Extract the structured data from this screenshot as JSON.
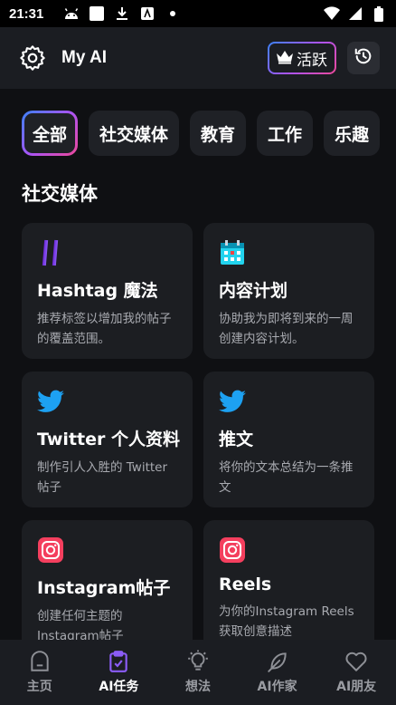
{
  "status_bar": {
    "time": "21:31"
  },
  "header": {
    "title": "My AI",
    "vip_label": "活跃"
  },
  "tabs": [
    {
      "label": "全部",
      "active": true
    },
    {
      "label": "社交媒体"
    },
    {
      "label": "教育"
    },
    {
      "label": "工作"
    },
    {
      "label": "乐趣"
    }
  ],
  "section": {
    "title": "社交媒体"
  },
  "cards": [
    {
      "icon": "hashtag-icon",
      "title": "Hashtag 魔法",
      "desc": "推荐标签以增加我的帖子的覆盖范围。"
    },
    {
      "icon": "calendar-icon",
      "title": "内容计划",
      "desc": "协助我为即将到来的一周创建内容计划。"
    },
    {
      "icon": "twitter-icon",
      "title": "Twitter 个人资料",
      "desc": "制作引人入胜的 Twitter 帖子"
    },
    {
      "icon": "twitter-icon",
      "title": "推文",
      "desc": "将你的文本总结为一条推文"
    },
    {
      "icon": "instagram-icon",
      "title": "Instagram帖子",
      "desc": "创建任何主题的Instagram帖子"
    },
    {
      "icon": "instagram-icon",
      "title": "Reels",
      "desc": "为你的Instagram Reels获取创意描述"
    }
  ],
  "bottom_nav": [
    {
      "label": "主页",
      "icon": "home-icon"
    },
    {
      "label": "AI任务",
      "icon": "clipboard-icon",
      "active": true
    },
    {
      "label": "想法",
      "icon": "lightbulb-icon"
    },
    {
      "label": "AI作家",
      "icon": "feather-icon"
    },
    {
      "label": "AI朋友",
      "icon": "heart-icon"
    }
  ],
  "colors": {
    "accent_blue": "#3b82f6",
    "accent_purple": "#a855f7",
    "accent_pink": "#ec4899",
    "twitter_blue": "#1da1f2"
  }
}
